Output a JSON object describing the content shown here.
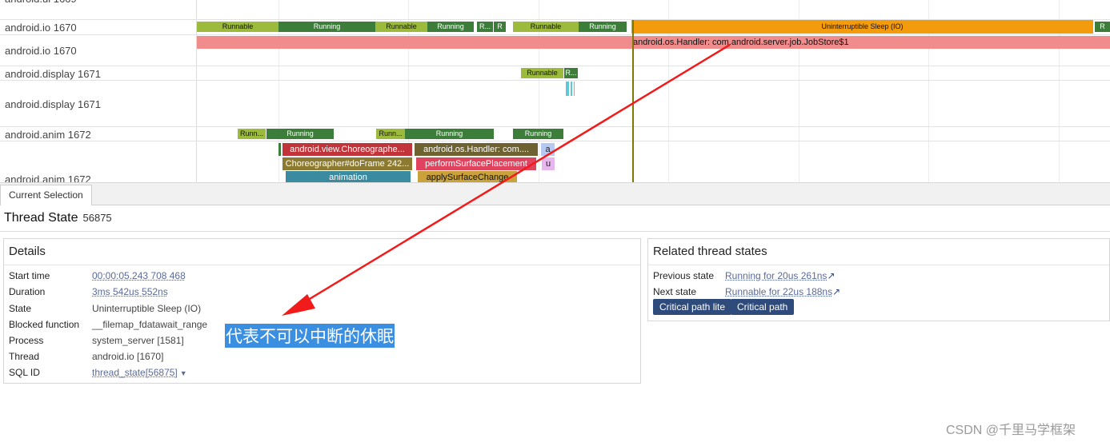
{
  "tracks": [
    {
      "label": "android.io 1670"
    },
    {
      "label": "android.io 1670"
    },
    {
      "label": "android.display 1671"
    },
    {
      "label": "android.display 1671"
    },
    {
      "label": "android.anim 1672"
    },
    {
      "label": "android.anim 1672"
    }
  ],
  "io_states": [
    {
      "text": "Runnable",
      "color": "#9cbb3c"
    },
    {
      "text": "Running",
      "color": "#3d7d3a"
    },
    {
      "text": "Runnable",
      "color": "#9cbb3c"
    },
    {
      "text": "Running",
      "color": "#3d7d3a"
    },
    {
      "text": "R...",
      "color": "#3d7d3a"
    },
    {
      "text": "R",
      "color": "#3d7d3a"
    },
    {
      "text": "Runnable",
      "color": "#9cbb3c"
    },
    {
      "text": "Running",
      "color": "#3d7d3a"
    },
    {
      "text": "Uninterruptible Sleep (IO)",
      "color": "#f29b0c"
    },
    {
      "text": "R",
      "color": "#3d7d3a"
    }
  ],
  "io_slice": {
    "text": "android.os.Handler: com.android.server.job.JobStore$1",
    "color": "#f08c8c"
  },
  "display_states": [
    {
      "text": "Runnable",
      "color": "#9cbb3c"
    },
    {
      "text": "R...",
      "color": "#3d7d3a"
    }
  ],
  "anim_states": [
    {
      "text": "Runn...",
      "color": "#9cbb3c"
    },
    {
      "text": "Running",
      "color": "#3d7d3a"
    },
    {
      "text": "Runn...",
      "color": "#9cbb3c"
    },
    {
      "text": "Running",
      "color": "#3d7d3a"
    },
    {
      "text": "Running",
      "color": "#3d7d3a"
    }
  ],
  "anim_slices": [
    {
      "text": "android.view.Choreographe...",
      "color": "#c0343a"
    },
    {
      "text": "android.os.Handler: com....",
      "color": "#6e6330"
    },
    {
      "text": "a",
      "color": "#b6c9f2"
    },
    {
      "text": "Choreographer#doFrame 242...",
      "color": "#8b7a30"
    },
    {
      "text": "performSurfacePlacement",
      "color": "#e0435e"
    },
    {
      "text": "u",
      "color": "#e7b6ee"
    },
    {
      "text": "animation",
      "color": "#3a8aa0"
    },
    {
      "text": "applySurfaceChange",
      "color": "#c9a23b"
    }
  ],
  "tab": {
    "label": "Current Selection"
  },
  "panel": {
    "title": "Thread State",
    "id": "56875"
  },
  "details": {
    "title": "Details",
    "rows": [
      {
        "key": "Start time",
        "value": "00:00:05.243 708 468"
      },
      {
        "key": "Duration",
        "value": "3ms 542us 552ns"
      },
      {
        "key": "State",
        "value": "Uninterruptible Sleep (IO)"
      },
      {
        "key": "Blocked function",
        "value": "__filemap_fdatawait_range"
      },
      {
        "key": "Process",
        "value": "system_server [1581]"
      },
      {
        "key": "Thread",
        "value": "android.io [1670]"
      },
      {
        "key": "SQL ID",
        "value": "thread_state[56875]"
      }
    ]
  },
  "related": {
    "title": "Related thread states",
    "previous_key": "Previous state",
    "previous_value": "Running for 20us 261ns",
    "next_key": "Next state",
    "next_value": "Runnable for 22us 188ns",
    "btn_lite": "Critical path lite",
    "btn_full": "Critical path"
  },
  "annotation": {
    "text": "代表不可以中断的休眠",
    "arrow_color": "#f21b1b"
  },
  "watermark": "CSDN @千里马学框架"
}
